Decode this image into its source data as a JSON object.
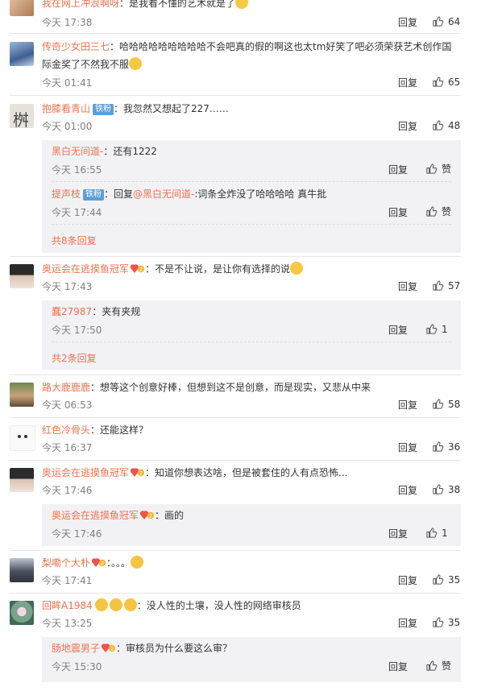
{
  "ui": {
    "reply_label": "回复",
    "more_reply_suffix": "条回复"
  },
  "comments": [
    {
      "user": "我在网上冲浪啊呀",
      "text": "：是我看不懂的艺术就是了",
      "time": "今天 17:38",
      "likes": "64"
    },
    {
      "user": "传奇少女田三七",
      "text": "：哈哈哈哈哈哈哈哈哈不会吧真的假的啊这也太tm好笑了吧必须荣获艺术创作国际金奖了不然我不服",
      "time": "今天 01:41",
      "likes": "65"
    },
    {
      "user": "抱膝看青山",
      "badge": "铁粉",
      "text": "：我忽然又想起了227……",
      "time": "今天 01:00",
      "likes": "48",
      "replies": [
        {
          "user": "黑白无间道-",
          "text": "：还有1222",
          "time": "今天 16:55",
          "likes": "赞"
        },
        {
          "user": "提声枝",
          "badge": "铁粉",
          "text_prefix": "：回复",
          "mention": "@黑白无间道-",
          "text": ":词条全炸没了哈哈哈哈 真牛批",
          "time": "今天 17:44",
          "likes": "赞"
        }
      ],
      "more": "共8条回复"
    },
    {
      "user": "奥运会在逃摸鱼冠军",
      "text": "：不是不让说，是让你有选择的说",
      "time": "今天 17:43",
      "likes": "57",
      "replies": [
        {
          "user": "蠢27987",
          "text": "：夹有夹规",
          "time": "今天 17:50",
          "likes": "1"
        }
      ],
      "more": "共2条回复"
    },
    {
      "user": "路大鹿鹿鹿",
      "text": "：想等这个创意好棒，但想到这不是创意，而是现实，又悲从中来",
      "time": "今天 06:53",
      "likes": "58"
    },
    {
      "user": "红色冷骨头",
      "text": "：还能这样？",
      "time": "今天 16:37",
      "likes": "36"
    },
    {
      "user": "奥运会在逃摸鱼冠军",
      "text": "：知道你想表达啥，但是被套住的人有点恐怖...",
      "time": "今天 17:46",
      "likes": "38",
      "replies": [
        {
          "user": "奥运会在逃摸鱼冠军",
          "text": "：画的",
          "time": "今天 17:46",
          "likes": "1"
        }
      ]
    },
    {
      "user": "梨嘞个大朴",
      "text": "：。。。",
      "time": "今天 17:41",
      "likes": "35"
    },
    {
      "user": "回眸A1984",
      "text": "：没人性的土壤，没人性的网络审核员",
      "time": "今天 13:25",
      "likes": "35",
      "replies": [
        {
          "user": "肠地震男子",
          "text": "：审核员为什么要这么审？",
          "time": "今天 15:30",
          "likes": "赞"
        }
      ]
    }
  ],
  "colors": {
    "username": "#eb7350",
    "time": "#808080",
    "subbg": "#f2f2f5",
    "badge": "#5b9fd6"
  }
}
